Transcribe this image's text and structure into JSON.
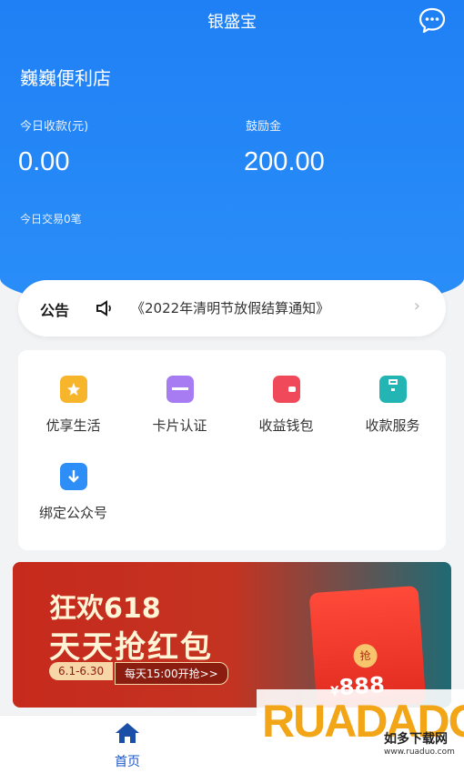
{
  "header": {
    "title": "银盛宝",
    "chat_icon": "chat-bubble-icon"
  },
  "store": {
    "name": "巍巍便利店"
  },
  "stats": {
    "today_income_label": "今日收款(元)",
    "today_income_value": "0.00",
    "bonus_label": "鼓励金",
    "bonus_value": "200.00",
    "today_tx": "今日交易0笔"
  },
  "notice": {
    "badge": "公告",
    "text": "《2022年清明节放假结算通知》",
    "arrow": "›"
  },
  "services": [
    {
      "label": "优享生活",
      "icon": "star-icon",
      "color": "#f7b52c"
    },
    {
      "label": "卡片认证",
      "icon": "card-icon",
      "color": "#a77cf2"
    },
    {
      "label": "收益钱包",
      "icon": "wallet-icon",
      "color": "#f04a5a"
    },
    {
      "label": "收款服务",
      "icon": "briefcase-icon",
      "color": "#22b5b3"
    },
    {
      "label": "绑定公众号",
      "icon": "download-icon",
      "color": "#2e8ef7"
    }
  ],
  "banner": {
    "line1": "狂欢618",
    "line2": "天天抢红包",
    "date_range": "6.1-6.30",
    "daily": "每天15:00开抢>>",
    "packet_badge": "抢",
    "amount": "888",
    "currency": "¥"
  },
  "tabbar": {
    "home_label": "首页",
    "home_icon": "home-icon"
  },
  "watermark": {
    "logo_a": "RUA",
    "logo_b": "DADO",
    "cn": "如多下载网",
    "url": "www.ruaduo.com"
  }
}
